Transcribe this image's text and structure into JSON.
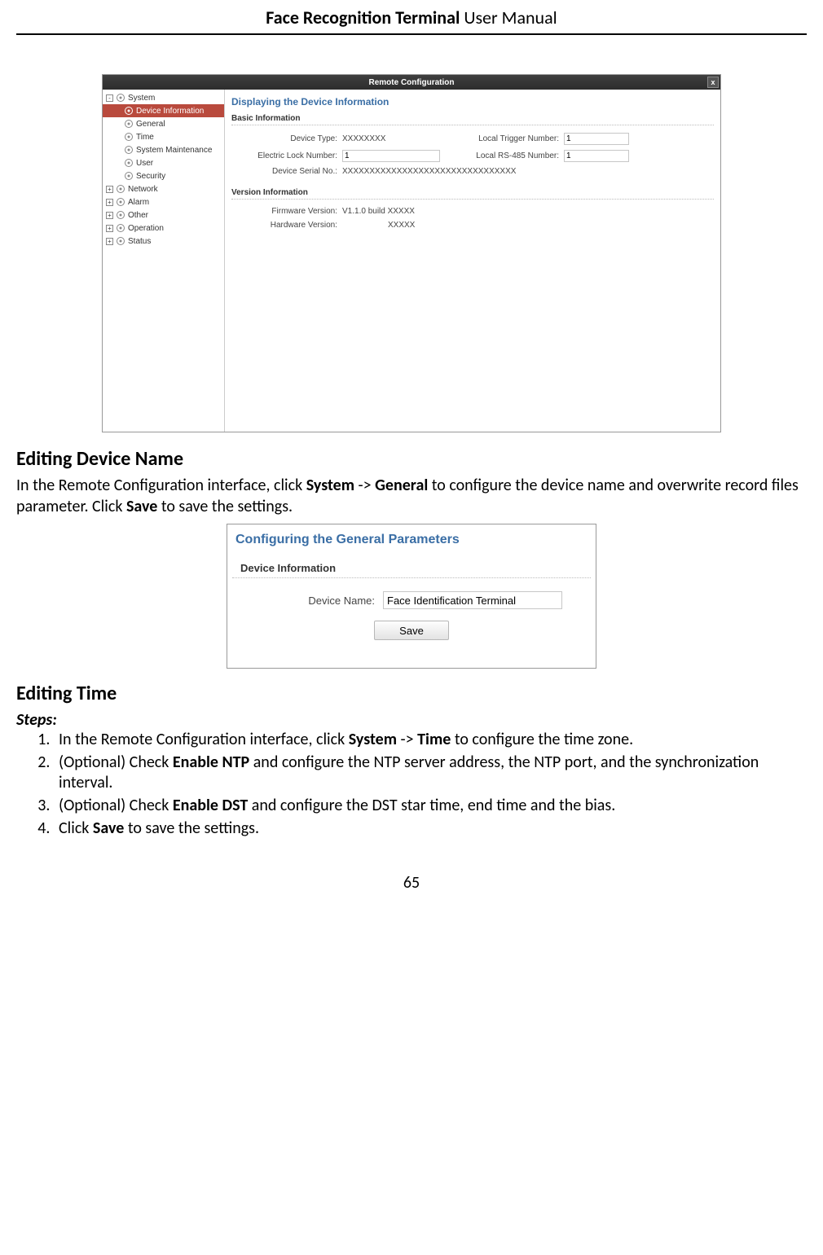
{
  "header": {
    "bold": "Face Recognition Terminal",
    "rest": "  User Manual"
  },
  "footer": {
    "page_number": "65"
  },
  "rc": {
    "title": "Remote Configuration",
    "sidebar": {
      "items": [
        {
          "label": "System",
          "expand": "-",
          "level": 0
        },
        {
          "label": "Device Information",
          "level": 1,
          "selected": true
        },
        {
          "label": "General",
          "level": 1
        },
        {
          "label": "Time",
          "level": 1
        },
        {
          "label": "System Maintenance",
          "level": 1
        },
        {
          "label": "User",
          "level": 1
        },
        {
          "label": "Security",
          "level": 1
        },
        {
          "label": "Network",
          "expand": "+",
          "level": 0
        },
        {
          "label": "Alarm",
          "expand": "+",
          "level": 0
        },
        {
          "label": "Other",
          "expand": "+",
          "level": 0
        },
        {
          "label": "Operation",
          "expand": "+",
          "level": 0
        },
        {
          "label": "Status",
          "expand": "+",
          "level": 0
        }
      ]
    },
    "main": {
      "heading": "Displaying the Device Information",
      "basic_title": "Basic Information",
      "device_type_label": "Device Type:",
      "device_type_value": "XXXXXXXX",
      "local_trigger_label": "Local Trigger Number:",
      "local_trigger_value": "1",
      "elock_label": "Electric Lock Number:",
      "elock_value": "1",
      "rs485_label": "Local RS-485 Number:",
      "rs485_value": "1",
      "serial_label": "Device Serial No.:",
      "serial_value": "XXXXXXXXXXXXXXXXXXXXXXXXXXXXXXXX",
      "version_title": "Version Information",
      "fw_label": "Firmware Version:",
      "fw_value": "V1.1.0 build XXXXX",
      "hw_label": "Hardware Version:",
      "hw_value": "XXXXX"
    }
  },
  "section1": {
    "title": "Editing Device Name",
    "text_pre": "In the Remote Configuration interface, click ",
    "sys": "System",
    "arrow": " -> ",
    "gen": "General",
    "text_mid": " to configure the device name and overwrite record files parameter. Click ",
    "save": "Save",
    "text_post": " to save the settings."
  },
  "gp": {
    "heading": "Configuring the General Parameters",
    "section": "Device Information",
    "name_label": "Device Name:",
    "name_value": "Face Identification Terminal",
    "save_label": "Save"
  },
  "section2": {
    "title": "Editing Time",
    "steps_label": "Steps:",
    "s1_pre": "In the Remote Configuration interface, click ",
    "s1_sys": "System",
    "s1_arrow": " -> ",
    "s1_time": "Time",
    "s1_post": " to configure the time zone.",
    "s2_pre": "(Optional) Check ",
    "s2_b": "Enable NTP",
    "s2_post": " and configure the NTP server address, the NTP port, and the synchronization interval.",
    "s3_pre": "(Optional) Check ",
    "s3_b": "Enable DST",
    "s3_post": " and configure the DST star time, end time and the bias.",
    "s4_pre": "Click ",
    "s4_b": "Save",
    "s4_post": " to save the settings."
  }
}
